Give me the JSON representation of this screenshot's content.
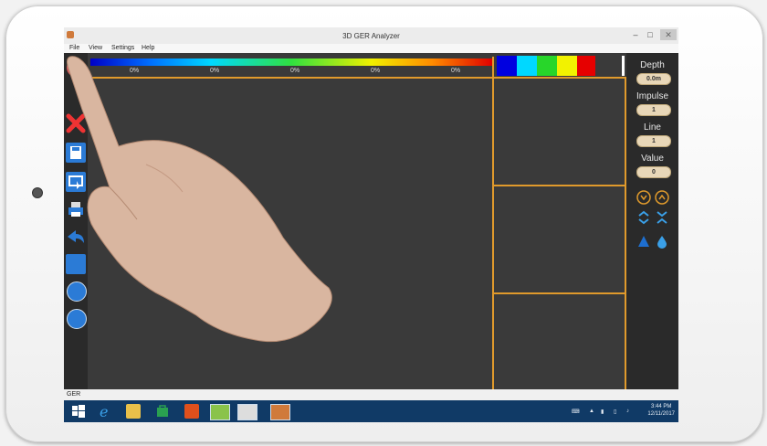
{
  "window": {
    "title": "3D GER Analyzer",
    "minimize": "–",
    "maximize": "□",
    "close": "✕"
  },
  "menu": {
    "items": [
      "File",
      "View",
      "Settings",
      "Help"
    ]
  },
  "scale": {
    "percentages": [
      "0%",
      "0%",
      "0%",
      "0%",
      "0%"
    ]
  },
  "swatch_colors": [
    "#0000e0",
    "#00d8ff",
    "#28d62a",
    "#f2f200",
    "#e60000"
  ],
  "status": {
    "text": "GER"
  },
  "right_panel": {
    "depth_label": "Depth",
    "depth_value": "0.0m",
    "impulse_label": "Impulse",
    "impulse_value": "1",
    "line_label": "Line",
    "line_value": "1",
    "value_label": "Value",
    "value_value": "0"
  },
  "taskbar": {
    "time": "3:44 PM",
    "date": "12/11/2017"
  },
  "colors": {
    "accent": "#e09a2c",
    "taskbar": "#103a66",
    "canvas": "#3a3a3a"
  },
  "icons": [
    "radar-icon",
    "close-icon",
    "save-icon",
    "window-cursor-icon",
    "printer-icon",
    "undo-icon",
    "blank-icon",
    "zoom-in-icon",
    "zoom-out-icon"
  ]
}
